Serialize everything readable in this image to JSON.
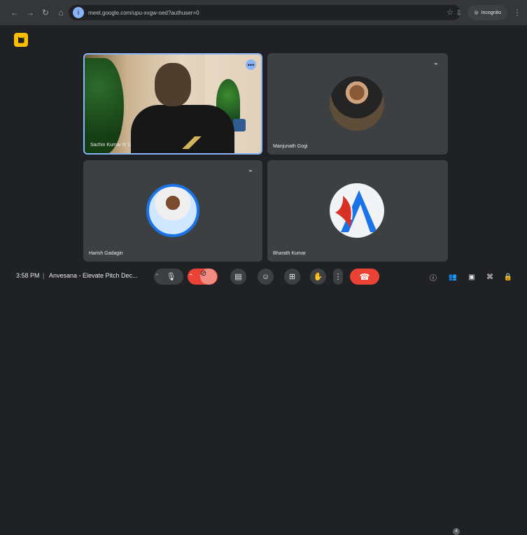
{
  "browser": {
    "url": "meet.google.com/upu-xvgw-oed?authuser=0",
    "incognito_label": "Incognito"
  },
  "participants": [
    {
      "name": "Sachin Kumar R S",
      "speaking": true
    },
    {
      "name": "Manjunath Gogi",
      "muted": true
    },
    {
      "name": "Harish Gadagin",
      "muted": true
    },
    {
      "name": "Bharath Kumar",
      "muted": false
    }
  ],
  "toolbar": {
    "time": "3:58 PM",
    "separator": "|",
    "meeting_name": "Anvesana - Elevate Pitch Dec...",
    "participant_count": "4"
  },
  "colors": {
    "background": "#202124",
    "tile": "#3c4043",
    "accent_blue": "#8ab4f8",
    "danger": "#ea4335",
    "warning": "#fbbc04"
  },
  "icons": {
    "app_badge": "camera-off-icon",
    "mic": "microphone-icon",
    "camera_off": "camera-off-icon",
    "captions": "captions-icon",
    "emoji": "emoji-icon",
    "present": "present-icon",
    "raise_hand": "raise-hand-icon",
    "more": "more-vert-icon",
    "end_call": "phone-hangup-icon",
    "info": "info-icon",
    "people": "people-icon",
    "chat": "chat-icon",
    "activities": "activities-icon",
    "lock": "lock-icon"
  }
}
